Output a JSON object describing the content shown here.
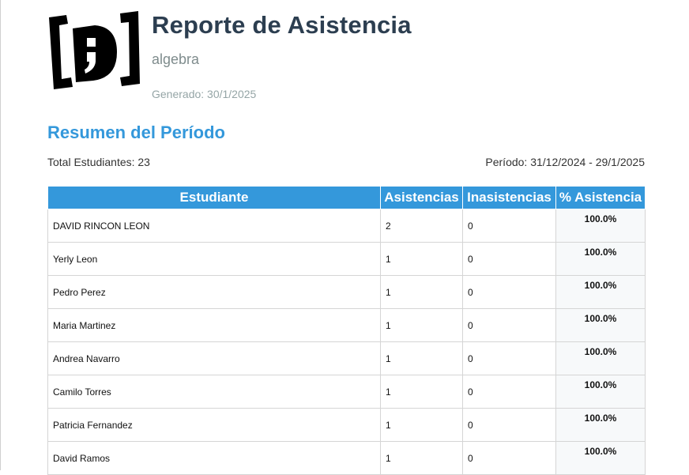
{
  "header": {
    "title": "Reporte de Asistencia",
    "subject": "algebra",
    "generated": "Generado: 30/1/2025"
  },
  "summary": {
    "section_title": "Resumen del Período",
    "total_students": "Total Estudiantes: 23",
    "period": "Período: 31/12/2024 - 29/1/2025"
  },
  "table": {
    "headers": [
      "Estudiante",
      "Asistencias",
      "Inasistencias",
      "% Asistencia"
    ],
    "rows": [
      [
        "DAVID RINCON LEON",
        "2",
        "0",
        "100.0%"
      ],
      [
        "Yerly Leon",
        "1",
        "0",
        "100.0%"
      ],
      [
        "Pedro Perez",
        "1",
        "0",
        "100.0%"
      ],
      [
        "Maria Martinez",
        "1",
        "0",
        "100.0%"
      ],
      [
        "Andrea Navarro",
        "1",
        "0",
        "100.0%"
      ],
      [
        "Camilo Torres",
        "1",
        "0",
        "100.0%"
      ],
      [
        "Patricia Fernandez",
        "1",
        "0",
        "100.0%"
      ],
      [
        "David Ramos",
        "1",
        "0",
        "100.0%"
      ]
    ]
  },
  "colors": {
    "title": "#2c3e50",
    "accent": "#3498db",
    "muted": "#7f8c8d"
  },
  "logo": {
    "icon": "bracket-d-logo-icon"
  }
}
